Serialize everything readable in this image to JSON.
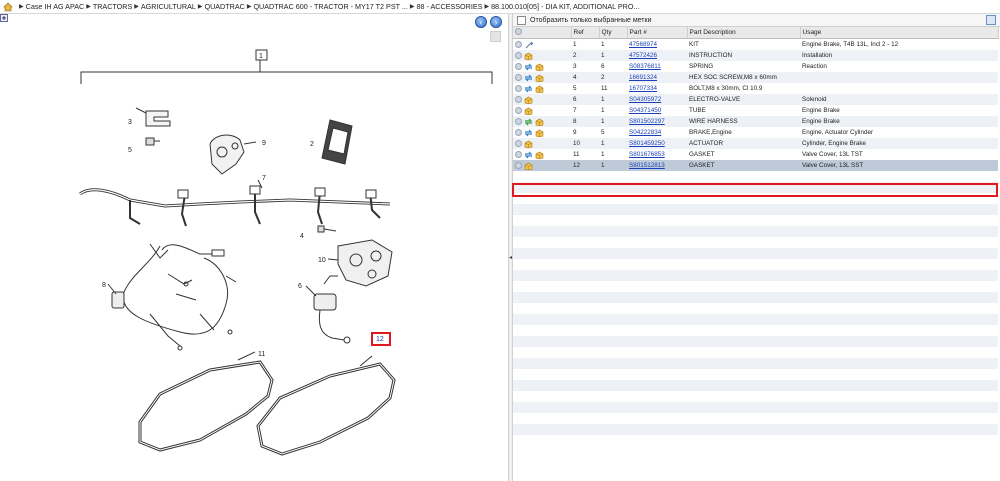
{
  "breadcrumb": {
    "items": [
      "Case IH AG APAC",
      "TRACTORS",
      "AGRICULTURAL",
      "QUADTRAC",
      "QUADTRAC 600 - TRACTOR - MY17 T2 PST ...",
      "88 - ACCESSORIES",
      "88.100.010[05] - DIA KIT, ADDITIONAL PRO..."
    ]
  },
  "diagram": {
    "callouts": [
      "1",
      "2",
      "3",
      "4",
      "5",
      "6",
      "7",
      "8",
      "9",
      "10",
      "11",
      "12"
    ]
  },
  "filter": {
    "label": "Отобразить только выбранные метки"
  },
  "table": {
    "headers": [
      "Ref",
      "Qty",
      "Part #",
      "Part Description",
      "Usage"
    ],
    "rows": [
      {
        "ref": "1",
        "qty": "1",
        "part": "47568974",
        "desc": "KIT",
        "usage": "Engine Brake, T4B 13L, Incl 2 - 12",
        "icons": [
          "wrench"
        ]
      },
      {
        "ref": "2",
        "qty": "1",
        "part": "47572426",
        "desc": "INSTRUCTION",
        "usage": "Installation",
        "icons": [
          "box"
        ]
      },
      {
        "ref": "3",
        "qty": "6",
        "part": "S08376811",
        "desc": "SPRING",
        "usage": "Reaction",
        "icons": [
          "swap",
          "box"
        ]
      },
      {
        "ref": "4",
        "qty": "2",
        "part": "16691324",
        "desc": "HEX SOC SCREW,M8 x 60mm",
        "usage": "",
        "icons": [
          "swap",
          "box"
        ]
      },
      {
        "ref": "5",
        "qty": "11",
        "part": "16707334",
        "desc": "BOLT,M8 x 30mm, Cl 10.9",
        "usage": "",
        "icons": [
          "swap",
          "box"
        ]
      },
      {
        "ref": "6",
        "qty": "1",
        "part": "S04305972",
        "desc": "ELECTRO-VALVE",
        "usage": "Solenoid",
        "icons": [
          "box"
        ]
      },
      {
        "ref": "7",
        "qty": "1",
        "part": "S04371450",
        "desc": "TUBE",
        "usage": "Engine Brake",
        "icons": [
          "box"
        ]
      },
      {
        "ref": "8",
        "qty": "1",
        "part": "S801502297",
        "desc": "WIRE HARNESS",
        "usage": "Engine Brake",
        "icons": [
          "swap-green",
          "box"
        ]
      },
      {
        "ref": "9",
        "qty": "5",
        "part": "S04222834",
        "desc": "BRAKE,Engine",
        "usage": "Engine, Actuator Cylinder",
        "icons": [
          "swap",
          "box"
        ]
      },
      {
        "ref": "10",
        "qty": "1",
        "part": "S801459250",
        "desc": "ACTUATOR",
        "usage": "Cylinder, Engine Brake",
        "icons": [
          "box"
        ]
      },
      {
        "ref": "11",
        "qty": "1",
        "part": "S801676853",
        "desc": "GASKET",
        "usage": "Valve Cover, 13L TST",
        "icons": [
          "swap",
          "box"
        ]
      },
      {
        "ref": "12",
        "qty": "1",
        "part": "S801512813",
        "desc": "GASKET",
        "usage": "Valve Cover, 13L SST",
        "icons": [
          "box"
        ],
        "selected": true
      }
    ]
  },
  "colors": {
    "highlight": "#e0191f",
    "link": "#1a3fb8",
    "selected_row": "#bfcad8"
  }
}
